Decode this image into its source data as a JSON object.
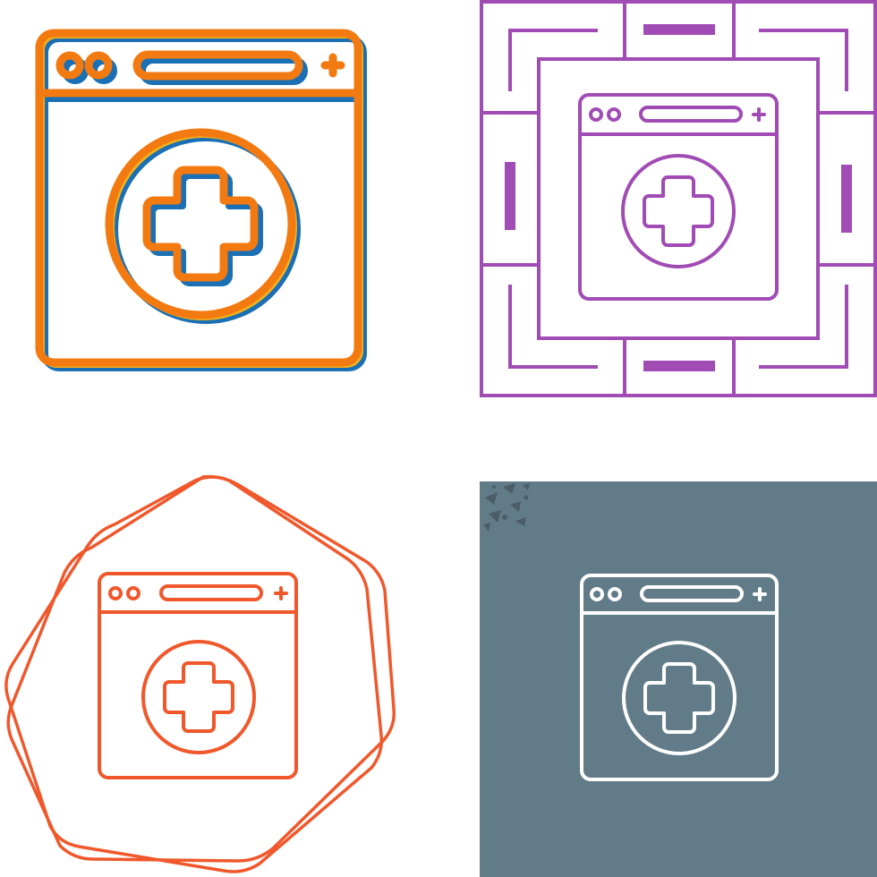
{
  "icon_name": "medical-browser-icon",
  "variants": [
    {
      "style": "offset-color",
      "primary": "#f27a10",
      "secondary": "#1a6fb5",
      "accent": "#f5b21a",
      "background": "#ffffff"
    },
    {
      "style": "line-maze-frame",
      "primary": "#a14bb5",
      "background": "#ffffff"
    },
    {
      "style": "line-badge-frame",
      "primary": "#f0582c",
      "background": "#ffffff"
    },
    {
      "style": "line-on-dark",
      "primary": "#ffffff",
      "background": "#627b89",
      "speckle": "#4a5d68"
    }
  ]
}
